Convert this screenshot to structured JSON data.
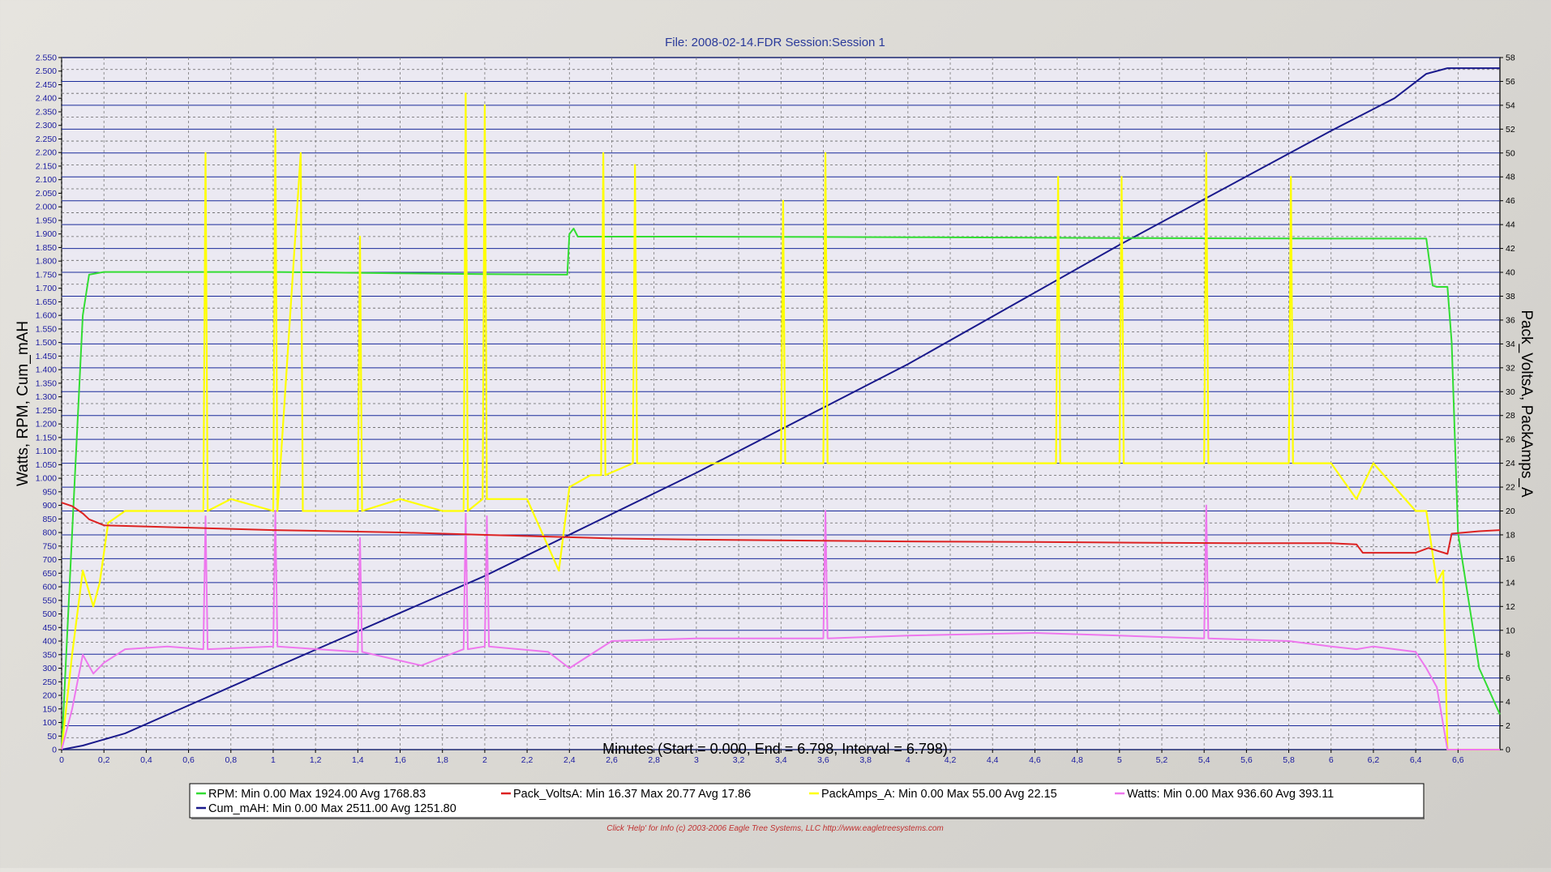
{
  "chart_data": {
    "type": "line",
    "title": "File: 2008-02-14.FDR   Session:Session 1",
    "xlabel": "Minutes (Start = 0.000,  End = 6.798,  Interval =  6.798)",
    "ylabel_left": "Watts, RPM, Cum_mAH",
    "ylabel_right": "Pack_VoltsA, PackAmps_A",
    "xlim": [
      0,
      6.798
    ],
    "ylim_left": [
      0,
      2550
    ],
    "ylim_right": [
      0,
      58
    ],
    "x_ticks": [
      "0",
      "0,2",
      "0,4",
      "0,6",
      "0,8",
      "1",
      "1,2",
      "1,4",
      "1,6",
      "1,8",
      "2",
      "2,2",
      "2,4",
      "2,6",
      "2,8",
      "3",
      "3,2",
      "3,4",
      "3,6",
      "3,8",
      "4",
      "4,2",
      "4,4",
      "4,6",
      "4,8",
      "5",
      "5,2",
      "5,4",
      "5,6",
      "5,8",
      "6",
      "6,2",
      "6,4",
      "6,6"
    ],
    "y_left_ticks": [
      "0",
      "50",
      "100",
      "150",
      "200",
      "250",
      "300",
      "350",
      "400",
      "450",
      "500",
      "550",
      "600",
      "650",
      "700",
      "750",
      "800",
      "850",
      "900",
      "950",
      "1.000",
      "1.050",
      "1.100",
      "1.150",
      "1.200",
      "1.250",
      "1.300",
      "1.350",
      "1.400",
      "1.450",
      "1.500",
      "1.550",
      "1.600",
      "1.650",
      "1.700",
      "1.750",
      "1.800",
      "1.850",
      "1.900",
      "1.950",
      "2.000",
      "2.050",
      "2.100",
      "2.150",
      "2.200",
      "2.250",
      "2.300",
      "2.350",
      "2.400",
      "2.450",
      "2.500",
      "2.550"
    ],
    "y_right_ticks": [
      "0",
      "2",
      "4",
      "6",
      "8",
      "10",
      "12",
      "14",
      "16",
      "18",
      "20",
      "22",
      "24",
      "26",
      "28",
      "30",
      "32",
      "34",
      "36",
      "38",
      "40",
      "42",
      "44",
      "46",
      "48",
      "50",
      "52",
      "54",
      "56",
      "58"
    ],
    "grid": true,
    "legend_position": "bottom",
    "series": [
      {
        "name": "RPM",
        "axis": "left",
        "color": "#33dd33",
        "legend": "RPM:  Min 0.00   Max 1924.00   Avg 1768.83",
        "x": [
          0,
          0.05,
          0.1,
          0.13,
          0.2,
          0.6,
          1.0,
          1.6,
          2.0,
          2.39,
          2.4,
          2.42,
          2.44,
          3.0,
          4.0,
          5.0,
          6.0,
          6.45,
          6.48,
          6.5,
          6.55,
          6.57,
          6.6,
          6.7,
          6.798
        ],
        "y": [
          0,
          800,
          1600,
          1750,
          1760,
          1760,
          1760,
          1755,
          1752,
          1750,
          1900,
          1920,
          1890,
          1890,
          1888,
          1885,
          1883,
          1883,
          1710,
          1705,
          1705,
          1500,
          800,
          300,
          130
        ]
      },
      {
        "name": "Pack_VoltsA",
        "axis": "right",
        "color": "#dd2222",
        "legend": "Pack_VoltsA:  Min 16.37   Max 20.77   Avg 17.86",
        "x": [
          0,
          0.05,
          0.1,
          0.13,
          0.2,
          0.6,
          1.0,
          1.6,
          2.0,
          2.4,
          2.6,
          3.0,
          3.6,
          4.0,
          4.6,
          5.0,
          5.6,
          6.0,
          6.12,
          6.15,
          6.4,
          6.46,
          6.55,
          6.57,
          6.7,
          6.798
        ],
        "y": [
          20.7,
          20.4,
          19.8,
          19.3,
          18.8,
          18.6,
          18.4,
          18.2,
          18.0,
          17.8,
          17.7,
          17.6,
          17.5,
          17.45,
          17.4,
          17.35,
          17.3,
          17.3,
          17.2,
          16.5,
          16.5,
          16.9,
          16.4,
          18.1,
          18.3,
          18.4
        ]
      },
      {
        "name": "PackAmps_A",
        "axis": "right",
        "color": "#ffff00",
        "legend": "PackAmps_A:  Min 0.00   Max 55.00   Avg 22.15",
        "x": [
          0,
          0.05,
          0.1,
          0.15,
          0.18,
          0.22,
          0.3,
          0.5,
          0.67,
          0.68,
          0.69,
          0.8,
          1.0,
          1.01,
          1.02,
          1.13,
          1.14,
          1.15,
          1.4,
          1.41,
          1.42,
          1.6,
          1.8,
          1.9,
          1.91,
          1.92,
          1.99,
          2.0,
          2.01,
          2.2,
          2.35,
          2.4,
          2.5,
          2.55,
          2.56,
          2.57,
          2.7,
          2.71,
          2.72,
          3.0,
          3.4,
          3.41,
          3.42,
          3.6,
          3.61,
          3.62,
          4.0,
          4.6,
          4.7,
          4.71,
          4.72,
          5.0,
          5.01,
          5.02,
          5.4,
          5.41,
          5.42,
          5.8,
          5.81,
          5.82,
          6.0,
          6.12,
          6.2,
          6.4,
          6.45,
          6.5,
          6.53,
          6.55,
          6.798
        ],
        "y": [
          0,
          8,
          15,
          12,
          14,
          19,
          20,
          20,
          20,
          50,
          20,
          21,
          20,
          52,
          20,
          50,
          20,
          20,
          20,
          43,
          20,
          21,
          20,
          20,
          55,
          20,
          21,
          54,
          21,
          21,
          15,
          22,
          23,
          23,
          50,
          23,
          24,
          49,
          24,
          24,
          24,
          46,
          24,
          24,
          50,
          24,
          24,
          24,
          24,
          48,
          24,
          24,
          48,
          24,
          24,
          50,
          24,
          24,
          48,
          24,
          24,
          21,
          24,
          20,
          20,
          14,
          15,
          0,
          0
        ]
      },
      {
        "name": "Watts",
        "axis": "left",
        "color": "#ee77ee",
        "legend": "Watts:  Min 0.00   Max 936.60   Avg 393.11",
        "x": [
          0,
          0.05,
          0.1,
          0.15,
          0.2,
          0.3,
          0.5,
          0.67,
          0.68,
          0.69,
          1.0,
          1.01,
          1.02,
          1.4,
          1.41,
          1.42,
          1.7,
          1.9,
          1.91,
          1.92,
          2.0,
          2.01,
          2.02,
          2.3,
          2.4,
          2.6,
          3.0,
          3.6,
          3.61,
          3.62,
          4.0,
          4.6,
          5.0,
          5.4,
          5.41,
          5.42,
          5.8,
          6.0,
          6.12,
          6.2,
          6.4,
          6.45,
          6.5,
          6.55,
          6.798
        ],
        "y": [
          0,
          150,
          350,
          280,
          320,
          370,
          380,
          370,
          860,
          370,
          380,
          880,
          380,
          360,
          780,
          360,
          310,
          370,
          870,
          370,
          380,
          860,
          380,
          360,
          300,
          400,
          410,
          410,
          880,
          410,
          420,
          430,
          420,
          410,
          900,
          410,
          400,
          380,
          370,
          380,
          360,
          300,
          230,
          0,
          0
        ]
      },
      {
        "name": "Cum_mAH",
        "axis": "left",
        "color": "#1a1a8c",
        "legend": "Cum_mAH:  Min 0.00   Max 2511.00   Avg 1251.80",
        "x": [
          0,
          0.1,
          0.3,
          1.0,
          2.0,
          3.0,
          4.0,
          5.0,
          6.0,
          6.3,
          6.45,
          6.55,
          6.798
        ],
        "y": [
          0,
          15,
          60,
          300,
          640,
          1020,
          1420,
          1860,
          2280,
          2400,
          2490,
          2511,
          2511
        ]
      }
    ],
    "footer": "Click 'Help' for Info  (c) 2003-2006 Eagle Tree Systems, LLC      http://www.eagletreesystems.com"
  }
}
